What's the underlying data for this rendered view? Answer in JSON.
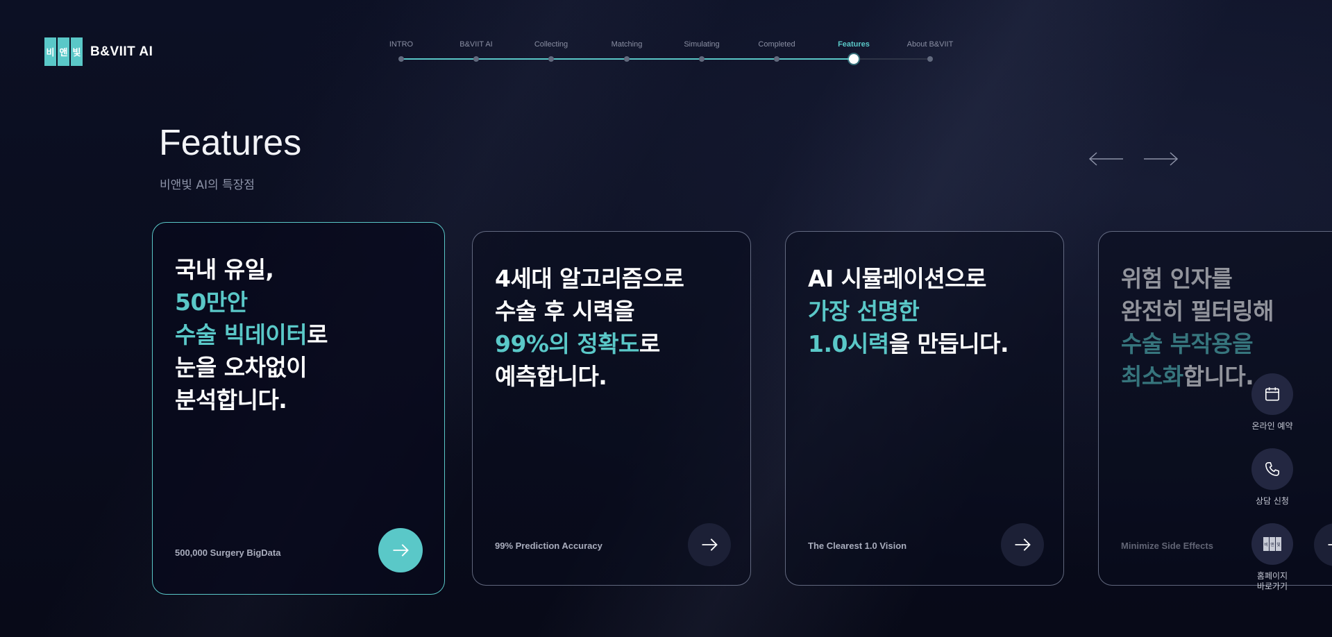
{
  "logo": {
    "mark": [
      "비",
      "앤",
      "빛"
    ],
    "brand": "B&VIIT AI"
  },
  "stepper": {
    "steps": [
      "INTRO",
      "B&VIIT AI",
      "Collecting",
      "Matching",
      "Simulating",
      "Completed",
      "Features",
      "About B&VIIT"
    ],
    "active_index": 6
  },
  "header": {
    "title": "Features",
    "subtitle": "비앤빛 AI의 특장점"
  },
  "carousel": {
    "prev_icon": "arrow-left-icon",
    "next_icon": "arrow-right-icon"
  },
  "cards": [
    {
      "lines": [
        [
          {
            "t": "국내 유일,",
            "h": false
          }
        ],
        [
          {
            "t": "50만안",
            "h": true
          }
        ],
        [
          {
            "t": "수술 빅데이터",
            "h": true
          },
          {
            "t": "로",
            "h": false
          }
        ],
        [
          {
            "t": "눈을 오차없이",
            "h": false
          }
        ],
        [
          {
            "t": "분석합니다.",
            "h": false
          }
        ]
      ],
      "caption": "500,000 Surgery BigData",
      "button_icon": "arrow-right-icon"
    },
    {
      "lines": [
        [
          {
            "t": "4세대 알고리즘으로",
            "h": false
          }
        ],
        [
          {
            "t": "수술 후 시력을",
            "h": false
          }
        ],
        [
          {
            "t": "99%의 정확도",
            "h": true
          },
          {
            "t": "로",
            "h": false
          }
        ],
        [
          {
            "t": "예측합니다.",
            "h": false
          }
        ]
      ],
      "caption": "99% Prediction Accuracy",
      "button_icon": "arrow-right-icon"
    },
    {
      "lines": [
        [
          {
            "t": "AI 시뮬레이션으로",
            "h": false
          }
        ],
        [
          {
            "t": "가장 선명한",
            "h": true
          }
        ],
        [
          {
            "t": "1.0시력",
            "h": true
          },
          {
            "t": "을 만듭니다.",
            "h": false
          }
        ]
      ],
      "caption": "The Clearest 1.0 Vision",
      "button_icon": "arrow-right-icon"
    },
    {
      "lines": [
        [
          {
            "t": "위험 인자를",
            "h": false
          }
        ],
        [
          {
            "t": "완전히 필터링해",
            "h": false
          }
        ],
        [
          {
            "t": "수술 부작용을",
            "h": true
          }
        ],
        [
          {
            "t": "최소화",
            "h": true
          },
          {
            "t": "합니다.",
            "h": false
          }
        ]
      ],
      "caption": "Minimize Side Effects",
      "button_icon": "arrow-right-icon"
    }
  ],
  "quick_menu": [
    {
      "label": "온라인 예약",
      "icon": "calendar-icon"
    },
    {
      "label": "상담 신청",
      "icon": "phone-icon"
    },
    {
      "label": "홈페이지\n바로가기",
      "icon": "home-logo-icon",
      "mark": [
        "비",
        "앤",
        "빛"
      ]
    }
  ],
  "colors": {
    "accent": "#5ac8c8",
    "background": "#0a0d1e",
    "inactive": "#8a8fa3"
  }
}
